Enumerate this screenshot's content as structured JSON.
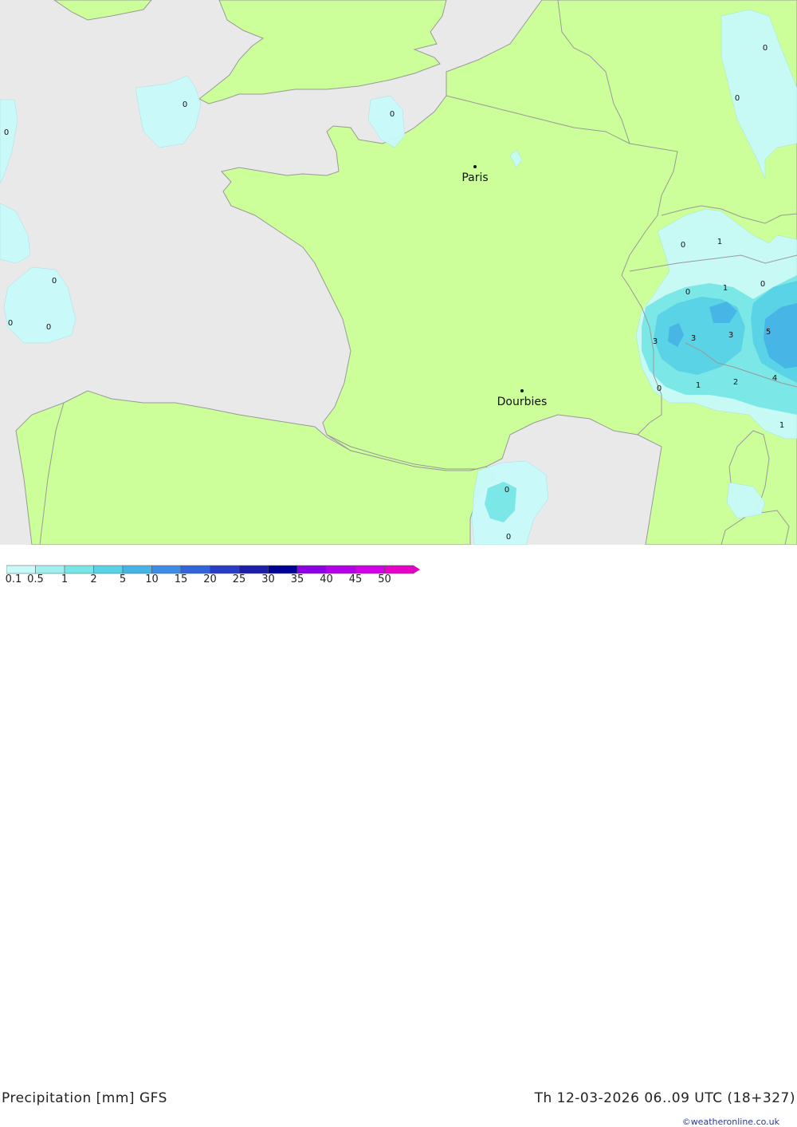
{
  "header": {
    "title": "Precipitation [mm] GFS",
    "valid_time": "Th 12-03-2026 06..09 UTC (18+327)",
    "credit": "©weatheronline.co.uk"
  },
  "colors": {
    "sea": "#e9e9e9",
    "land": "#ccff99",
    "border": "#999999"
  },
  "map": {
    "cities": [
      {
        "name": "Paris"
      },
      {
        "name": "Dourbies"
      }
    ],
    "precip_labels": [
      "0",
      "0",
      "0",
      "0",
      "0",
      "0",
      "0",
      "0",
      "0",
      "0",
      "0",
      "0",
      "0",
      "1",
      "1",
      "1",
      "0",
      "3",
      "3",
      "3",
      "5",
      "0",
      "1",
      "2",
      "4",
      "1",
      "0",
      "0"
    ]
  },
  "legend": {
    "ticks": [
      "0.1",
      "0.5",
      "1",
      "2",
      "5",
      "10",
      "15",
      "20",
      "25",
      "30",
      "35",
      "40",
      "45",
      "50"
    ],
    "colors": [
      "#c8fafa",
      "#a0f0f0",
      "#78e6e6",
      "#5ad2e6",
      "#46b4e6",
      "#3c8ce6",
      "#3264dc",
      "#283cc8",
      "#1e1eaa",
      "#000096",
      "#8c00e6",
      "#b400e6",
      "#d200e6",
      "#e600c8"
    ]
  }
}
